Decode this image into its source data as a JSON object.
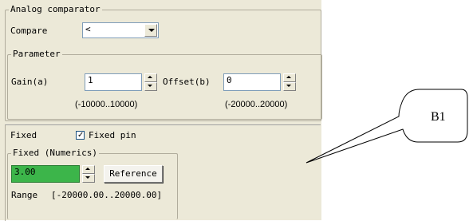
{
  "analog_comparator": {
    "group_label": "Analog comparator",
    "compare_label": "Compare",
    "compare_value": "<",
    "parameter": {
      "group_label": "Parameter",
      "gain_label": "Gain(a)",
      "gain_value": "1",
      "gain_range": "(-10000..10000)",
      "offset_label": "Offset(b)",
      "offset_value": "0",
      "offset_range": "(-20000..20000)"
    }
  },
  "fixed": {
    "label": "Fixed",
    "checkbox_label": "Fixed pin",
    "checked": true,
    "numerics": {
      "group_label": "Fixed (Numerics)",
      "value": "3.00",
      "value_bg": "#3cb54a",
      "reference_button": "Reference",
      "range_label": "Range",
      "range_value": "[-20000.00..20000.00]"
    }
  },
  "callout": {
    "label": "B1"
  }
}
